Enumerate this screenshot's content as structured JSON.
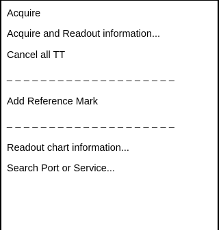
{
  "menu": {
    "items": [
      {
        "label": "Acquire"
      },
      {
        "label": "Acquire and Readout information..."
      },
      {
        "label": "Cancel all TT"
      },
      {
        "separator": "_ _ _ _ _ _ _ _ _ _ _ _ _ _ _ _ _ _ _ _"
      },
      {
        "label": "Add Reference Mark"
      },
      {
        "separator": "_ _ _ _ _ _ _ _ _ _ _ _ _ _ _ _ _ _ _ _"
      },
      {
        "label": "Readout chart information..."
      },
      {
        "label": "Search Port or Service..."
      }
    ]
  }
}
